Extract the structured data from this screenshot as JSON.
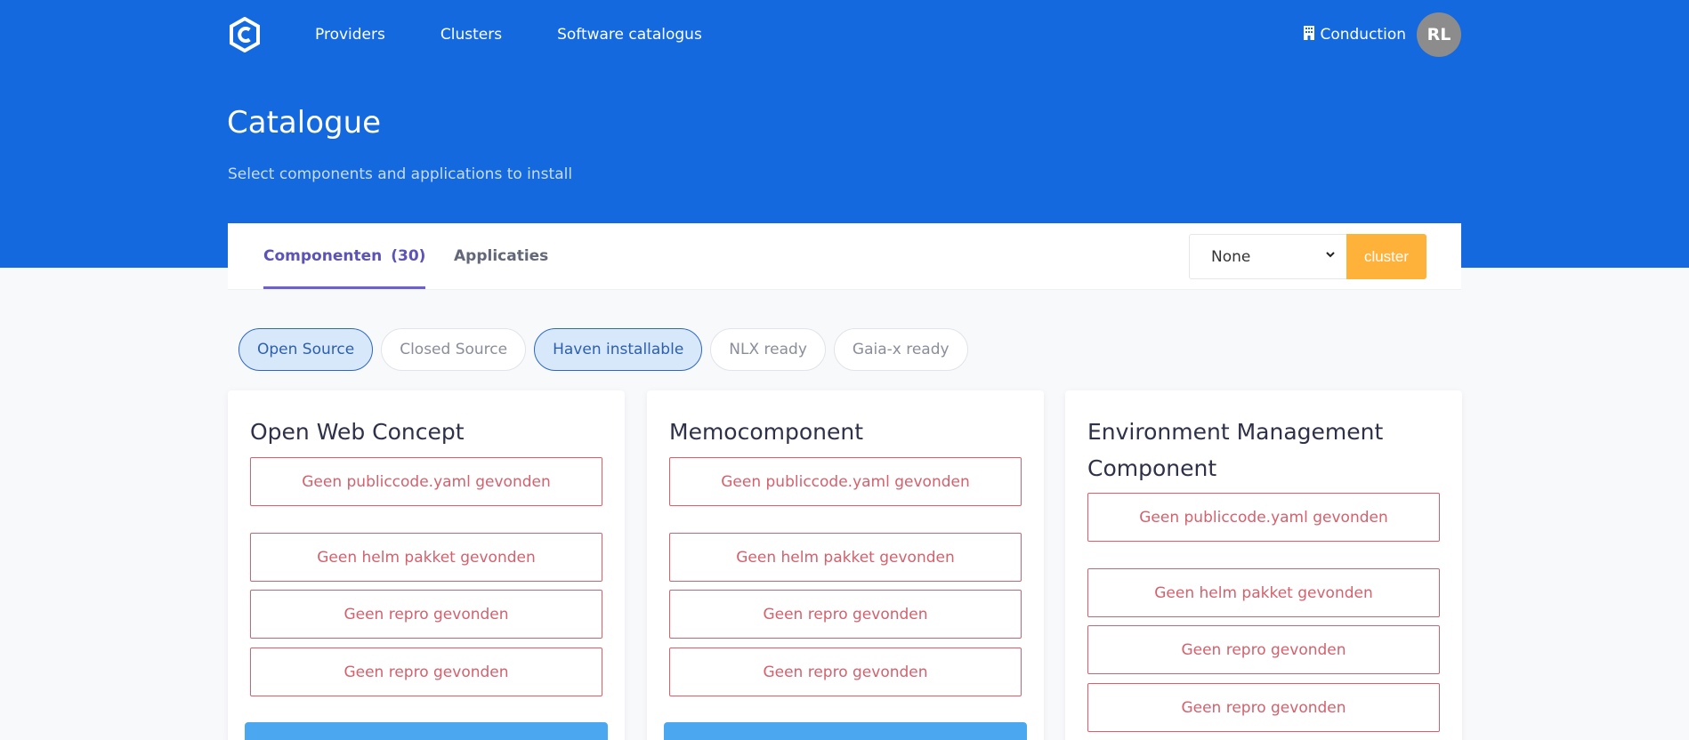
{
  "nav": {
    "links": [
      "Providers",
      "Clusters",
      "Software catalogus"
    ],
    "organization": "Conduction",
    "avatar_initials": "RL",
    "org_icon": "building-icon",
    "logo_icon": "hexagon-c-logo"
  },
  "header": {
    "title": "Catalogue",
    "subtitle": "Select components and applications to install"
  },
  "tabs": {
    "components_label": "Componenten",
    "components_count": "(30)",
    "applications_label": "Applicaties"
  },
  "cluster": {
    "selected": "None",
    "button_label": "cluster"
  },
  "filters": [
    {
      "label": "Open Source",
      "active": true
    },
    {
      "label": "Closed Source",
      "active": false
    },
    {
      "label": "Haven installable",
      "active": true
    },
    {
      "label": "NLX ready",
      "active": false
    },
    {
      "label": "Gaia-x ready",
      "active": false
    }
  ],
  "cards": [
    {
      "title": "Open Web Concept",
      "warnings": [
        "Geen publiccode.yaml gevonden",
        "Geen helm pakket gevonden",
        "Geen repro gevonden",
        "Geen repro gevonden"
      ]
    },
    {
      "title": "Memocomponent",
      "warnings": [
        "Geen publiccode.yaml gevonden",
        "Geen helm pakket gevonden",
        "Geen repro gevonden",
        "Geen repro gevonden"
      ]
    },
    {
      "title": "Environment Management Component",
      "warnings": [
        "Geen publiccode.yaml gevonden",
        "Geen helm pakket gevonden",
        "Geen repro gevonden",
        "Geen repro gevonden"
      ]
    }
  ],
  "colors": {
    "hero": "#1469de",
    "accent_tab": "#5b53b8",
    "cluster_button": "#ffb239",
    "warning": "#d4616d",
    "card_action": "#4ba8f0"
  }
}
